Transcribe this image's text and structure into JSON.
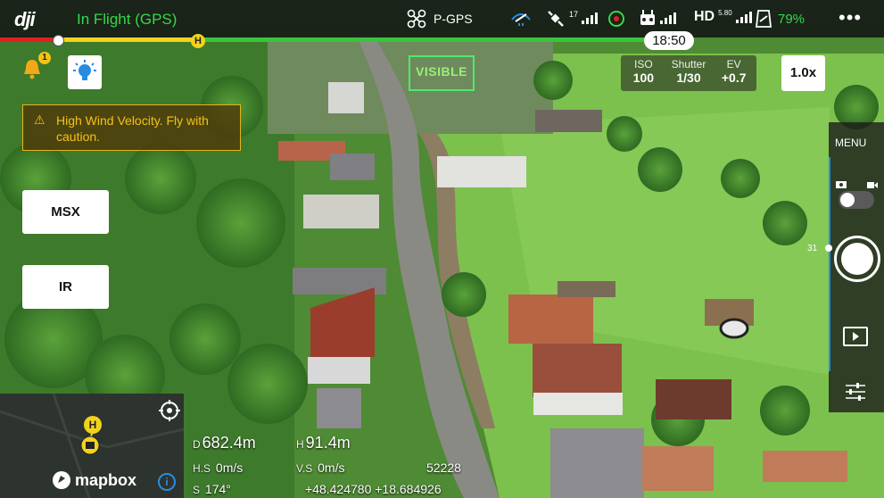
{
  "app": {
    "logo": "dji",
    "flight_status": "In Flight (GPS)"
  },
  "status_bar": {
    "mode": "P-GPS",
    "satellites": "17",
    "hd_signal": "HD",
    "hd_freq": "5.80",
    "battery": "79%",
    "more": "•••"
  },
  "timeline": {
    "remaining_time": "18:50",
    "home_marker": "H"
  },
  "camera": {
    "view_label": "VISIBLE",
    "iso_label": "ISO",
    "iso": "100",
    "shutter_label": "Shutter",
    "shutter": "1/30",
    "ev_label": "EV",
    "ev": "+0.7",
    "zoom": "1.0x"
  },
  "alert": {
    "count": "1",
    "message": "High Wind Velocity. Fly with caution."
  },
  "side_buttons": {
    "msx": "MSX",
    "ir": "IR"
  },
  "map": {
    "brand": "mapbox",
    "home_label": "H",
    "info": "i"
  },
  "telemetry": {
    "distance_label": "D",
    "distance": "682.4m",
    "height_label": "H",
    "height": "91.4m",
    "hspeed_label": "H.S",
    "hspeed": "0m/s",
    "vspeed_label": "V.S",
    "vspeed": "0m/s",
    "heading_label": "S",
    "heading": "174°",
    "coords": "+48.424780 +18.684926",
    "id": "52228"
  },
  "right_panel": {
    "menu": "MENU",
    "slider_value": "31"
  },
  "colors": {
    "accent_green": "#35d84a",
    "warning": "#f3c21b",
    "progress_red": "#e02020",
    "progress_yellow": "#f2d31b",
    "progress_green": "#39c43c",
    "blue": "#2a8be0"
  }
}
